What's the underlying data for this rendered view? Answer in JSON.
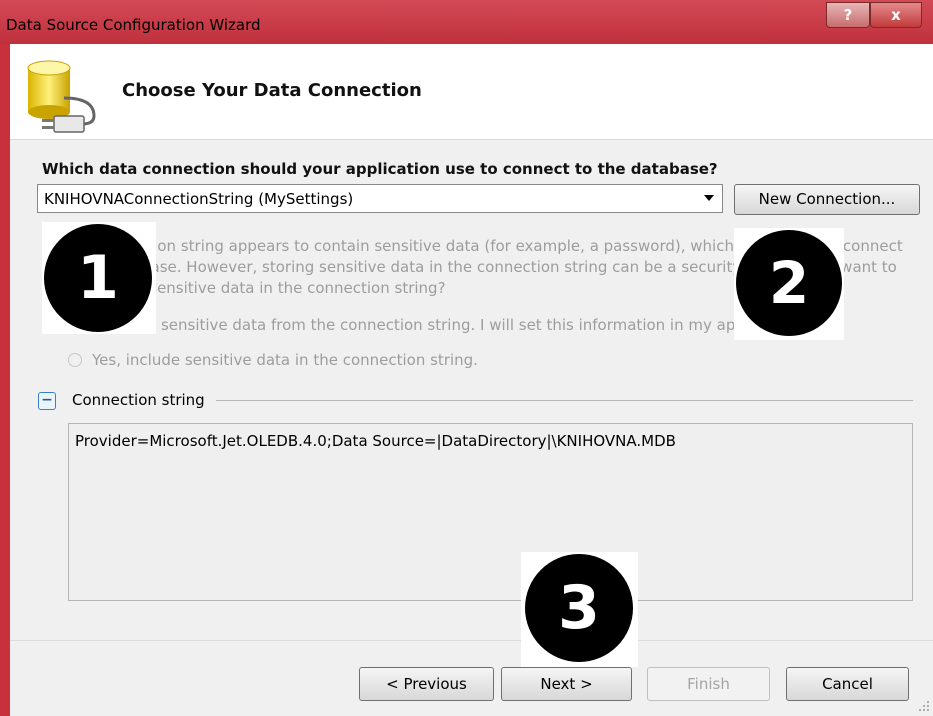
{
  "window": {
    "title": "Data Source Configuration Wizard",
    "help_glyph": "?",
    "close_glyph": "x"
  },
  "header": {
    "title": "Choose Your Data Connection",
    "icon": "database-plug-icon"
  },
  "connection": {
    "question": "Which data connection should your application use to connect to the database?",
    "selected": "KNIHOVNAConnectionString (MySettings)",
    "new_connection_label": "New Connection..."
  },
  "sensitive": {
    "text": "This connection string appears to contain sensitive data (for example, a password), which is required to connect to the database. However, storing sensitive data in the connection string can be a security risk. Do you want to include this sensitive data in the connection string?",
    "option_no": "No, exclude sensitive data from the connection string. I will set this information in my application code.",
    "option_yes": "Yes, include sensitive data in the connection string."
  },
  "connection_string": {
    "collapse_glyph": "−",
    "label": "Connection string",
    "value": "Provider=Microsoft.Jet.OLEDB.4.0;Data Source=|DataDirectory|\\KNIHOVNA.MDB"
  },
  "footer": {
    "previous_label": "< Previous",
    "next_label": "Next >",
    "finish_label": "Finish",
    "cancel_label": "Cancel"
  },
  "callouts": [
    "1",
    "2",
    "3"
  ],
  "colors": {
    "titlebar": "#c0303d",
    "disabled_text": "#9d9d9d",
    "callout_disc": "#000000"
  }
}
